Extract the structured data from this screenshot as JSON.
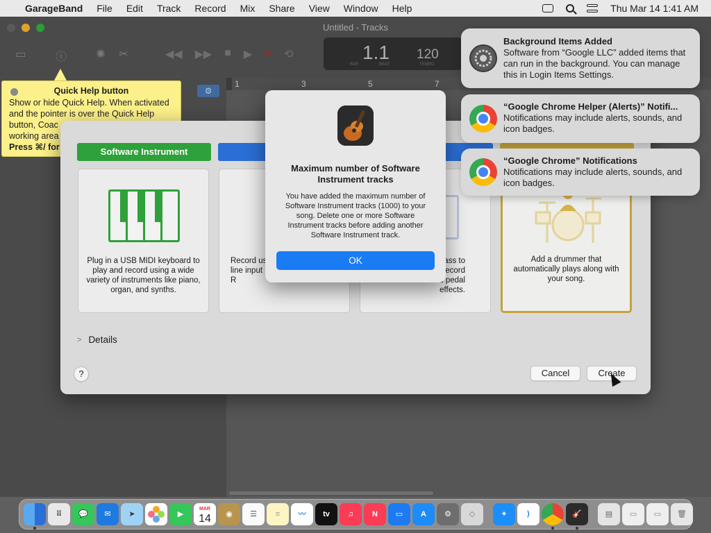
{
  "menubar": {
    "app": "GarageBand",
    "items": [
      "File",
      "Edit",
      "Track",
      "Record",
      "Mix",
      "Share",
      "View",
      "Window",
      "Help"
    ],
    "clock": "Thu Mar 14  1:41 AM"
  },
  "window": {
    "title": "Untitled - Tracks",
    "lcd": {
      "position": "1.1",
      "tempo": "120",
      "bar_label": "BAR",
      "beat_label": "BEAT",
      "tempo_label": "TEMPO"
    },
    "ruler": [
      "1",
      "3",
      "5",
      "7"
    ]
  },
  "quick_help": {
    "title": "Quick Help button",
    "text": "Show or hide Quick Help. When activated\nand the pointer is over the Quick Help\nbutton, Coac\nworking area",
    "bold_text": "Press ⌘/ for"
  },
  "new_track": {
    "tabs": [
      "Software Instrument",
      "",
      "",
      ""
    ],
    "cards": [
      {
        "desc": "Plug in a USB MIDI keyboard to play and record using a wide variety of instruments like piano, organ, and synths."
      },
      {
        "desc": "Record us\nline input\nR"
      },
      {
        "desc": "r bass to\nd record\nt and pedal\neffects."
      },
      {
        "desc": "Add a drummer that automatically plays along with your song."
      }
    ],
    "details_label": "Details",
    "help_label": "?",
    "cancel_label": "Cancel",
    "create_label": "Create"
  },
  "alert": {
    "title": "Maximum number of Software Instrument tracks",
    "message": "You have added the maximum number of Software Instrument tracks (1000) to your song. Delete one or more Software Instrument tracks before adding another Software Instrument track.",
    "ok_label": "OK"
  },
  "notifications": [
    {
      "title": "Background Items Added",
      "body": "Software from “Google LLC” added items that can run in the background. You can manage this in Login Items Settings.",
      "icon": "system-settings-icon"
    },
    {
      "title": "“Google Chrome Helper (Alerts)” Notifi...",
      "body": "Notifications may include alerts, sounds, and icon badges.",
      "icon": "chrome-icon"
    },
    {
      "title": "“Google Chrome” Notifications",
      "body": "Notifications may include alerts, sounds, and icon badges.",
      "icon": "chrome-icon"
    }
  ],
  "dock": {
    "calendar_month": "MAR",
    "calendar_day": "14",
    "tv_label": "tv"
  },
  "colors": {
    "software_instrument_green": "#2ea13a",
    "audio_blue": "#2b6fd6",
    "drummer_gold": "#c3a23b",
    "ok_blue": "#1a7cf5"
  }
}
